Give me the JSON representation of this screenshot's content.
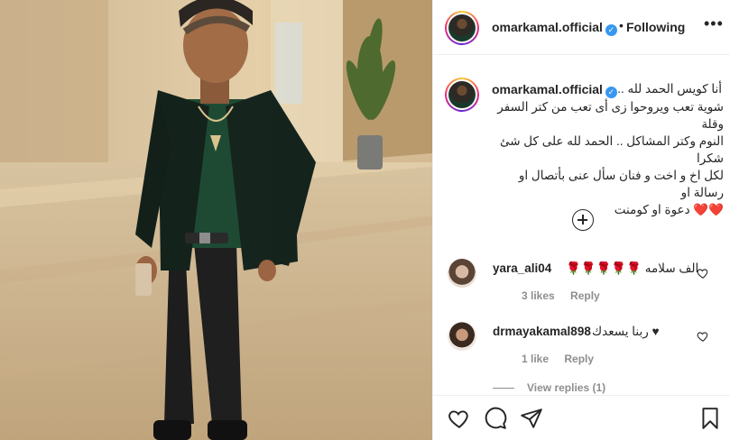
{
  "post": {
    "username": "omarkamal.official",
    "verified_icon": "verified-badge-icon",
    "separator": "•",
    "follow_state": "Following",
    "more_icon": "more-options-icon"
  },
  "caption": {
    "username": "omarkamal.official",
    "first_line": "أنا كويس الحمد لله ..",
    "lines": "شوية تعب ويروحوا زى أى تعب من كتر السفر وقلة\nالنوم وكتر المشاكل .. الحمد لله على كل شئ شكرا\nلكل اخ و اخت و فنان سأل عنى بأتصال او رسالة او\n❤️❤️ دعوة او كومنت",
    "load_more_icon": "add-circle-icon"
  },
  "comments": [
    {
      "username": "yara_ali04",
      "text": "الف سلامه 🌹🌹🌹🌹🌹",
      "likes": "3 likes",
      "reply": "Reply"
    },
    {
      "username": "drmayakamal898",
      "text": "♥ ربنا يسعدك",
      "likes": "1 like",
      "reply": "Reply",
      "view_replies": "View replies (1)"
    }
  ],
  "actions": {
    "like_icon": "heart-icon",
    "comment_icon": "comment-icon",
    "share_icon": "share-icon",
    "save_icon": "bookmark-icon"
  },
  "colors": {
    "verified": "#3897f0",
    "text": "#262626",
    "meta": "#8e8e8e",
    "border": "#efefef"
  }
}
